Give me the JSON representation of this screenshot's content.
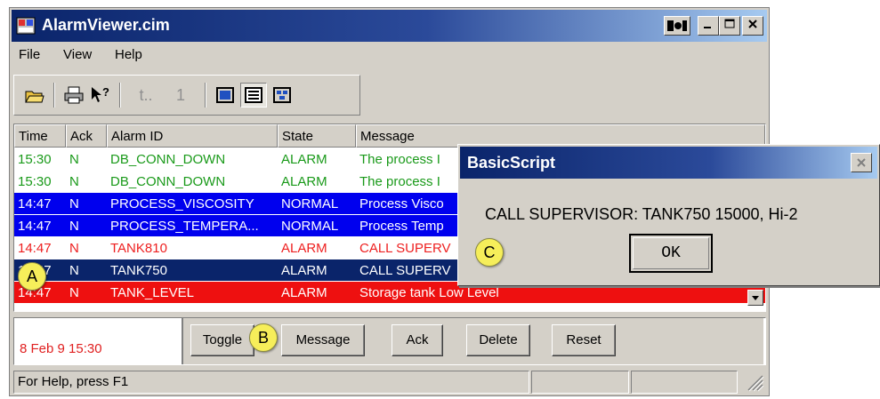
{
  "window": {
    "title": "AlarmViewer.cim",
    "menu": [
      "File",
      "View",
      "Help"
    ]
  },
  "toolbar": {
    "page_number": "1",
    "nav_label": "t.."
  },
  "grid": {
    "columns": [
      "Time",
      "Ack",
      "Alarm ID",
      "State",
      "Message"
    ],
    "rows": [
      {
        "time": "15:30",
        "ack": "N",
        "id": "DB_CONN_DOWN",
        "state": "ALARM",
        "message": "The process I",
        "fg": "#1a9a1a",
        "bg": "#ffffff"
      },
      {
        "time": "15:30",
        "ack": "N",
        "id": "DB_CONN_DOWN",
        "state": "ALARM",
        "message": "The process I",
        "fg": "#1a9a1a",
        "bg": "#ffffff"
      },
      {
        "time": "14:47",
        "ack": "N",
        "id": "PROCESS_VISCOSITY",
        "state": "NORMAL",
        "message": "Process Visco",
        "fg": "#ffffff",
        "bg": "#0000ee"
      },
      {
        "time": "14:47",
        "ack": "N",
        "id": "PROCESS_TEMPERA...",
        "state": "NORMAL",
        "message": "Process Temp",
        "fg": "#ffffff",
        "bg": "#0000ee"
      },
      {
        "time": "14:47",
        "ack": "N",
        "id": "TANK810",
        "state": "ALARM",
        "message": "CALL SUPERV",
        "fg": "#ee2020",
        "bg": "#ffffff"
      },
      {
        "time": "14:47",
        "ack": "N",
        "id": "TANK750",
        "state": "ALARM",
        "message": "CALL SUPERV",
        "fg": "#ffffff",
        "bg": "#0a246a"
      },
      {
        "time": "14:47",
        "ack": "N",
        "id": "TANK_LEVEL",
        "state": "ALARM",
        "message": "Storage tank Low Level",
        "fg": "#ffffff",
        "bg": "#ee1010"
      }
    ]
  },
  "bottom": {
    "datetime": "8 Feb 9 15:30",
    "buttons": {
      "toggle": "Toggle",
      "message": "Message",
      "ack": "Ack",
      "delete": "Delete",
      "reset": "Reset"
    }
  },
  "status": {
    "help": "For Help, press F1"
  },
  "dialog": {
    "title": "BasicScript",
    "message": "CALL SUPERVISOR: TANK750 15000, Hi-2",
    "ok": "OK"
  },
  "markers": {
    "a": "A",
    "b": "B",
    "c": "C"
  },
  "colors": {
    "title_bar": "#0a246a",
    "face": "#d4d0c8",
    "marker": "#f6ee5a"
  }
}
